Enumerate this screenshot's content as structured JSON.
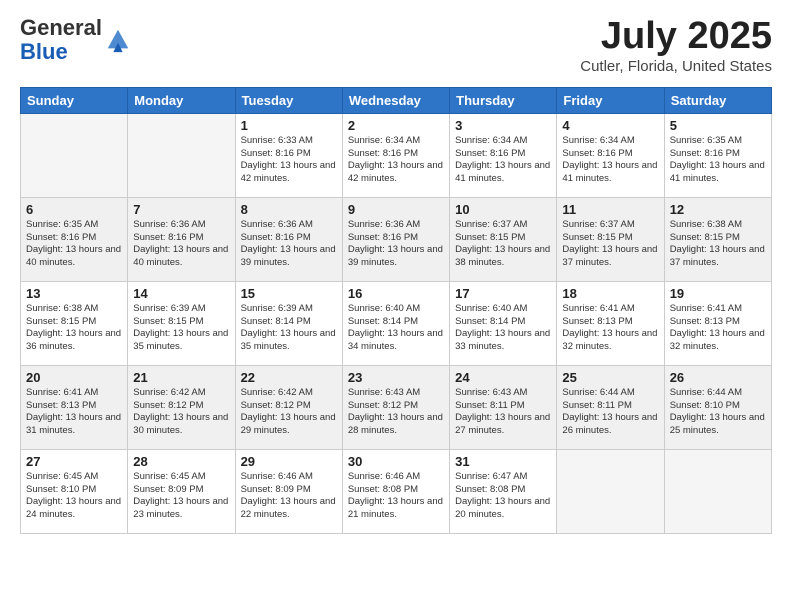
{
  "header": {
    "logo_general": "General",
    "logo_blue": "Blue",
    "title": "July 2025",
    "location": "Cutler, Florida, United States"
  },
  "days_of_week": [
    "Sunday",
    "Monday",
    "Tuesday",
    "Wednesday",
    "Thursday",
    "Friday",
    "Saturday"
  ],
  "weeks": [
    [
      {
        "day": "",
        "info": "",
        "empty": true
      },
      {
        "day": "",
        "info": "",
        "empty": true
      },
      {
        "day": "1",
        "info": "Sunrise: 6:33 AM\nSunset: 8:16 PM\nDaylight: 13 hours and 42 minutes.",
        "empty": false
      },
      {
        "day": "2",
        "info": "Sunrise: 6:34 AM\nSunset: 8:16 PM\nDaylight: 13 hours and 42 minutes.",
        "empty": false
      },
      {
        "day": "3",
        "info": "Sunrise: 6:34 AM\nSunset: 8:16 PM\nDaylight: 13 hours and 41 minutes.",
        "empty": false
      },
      {
        "day": "4",
        "info": "Sunrise: 6:34 AM\nSunset: 8:16 PM\nDaylight: 13 hours and 41 minutes.",
        "empty": false
      },
      {
        "day": "5",
        "info": "Sunrise: 6:35 AM\nSunset: 8:16 PM\nDaylight: 13 hours and 41 minutes.",
        "empty": false
      }
    ],
    [
      {
        "day": "6",
        "info": "Sunrise: 6:35 AM\nSunset: 8:16 PM\nDaylight: 13 hours and 40 minutes.",
        "empty": false
      },
      {
        "day": "7",
        "info": "Sunrise: 6:36 AM\nSunset: 8:16 PM\nDaylight: 13 hours and 40 minutes.",
        "empty": false
      },
      {
        "day": "8",
        "info": "Sunrise: 6:36 AM\nSunset: 8:16 PM\nDaylight: 13 hours and 39 minutes.",
        "empty": false
      },
      {
        "day": "9",
        "info": "Sunrise: 6:36 AM\nSunset: 8:16 PM\nDaylight: 13 hours and 39 minutes.",
        "empty": false
      },
      {
        "day": "10",
        "info": "Sunrise: 6:37 AM\nSunset: 8:15 PM\nDaylight: 13 hours and 38 minutes.",
        "empty": false
      },
      {
        "day": "11",
        "info": "Sunrise: 6:37 AM\nSunset: 8:15 PM\nDaylight: 13 hours and 37 minutes.",
        "empty": false
      },
      {
        "day": "12",
        "info": "Sunrise: 6:38 AM\nSunset: 8:15 PM\nDaylight: 13 hours and 37 minutes.",
        "empty": false
      }
    ],
    [
      {
        "day": "13",
        "info": "Sunrise: 6:38 AM\nSunset: 8:15 PM\nDaylight: 13 hours and 36 minutes.",
        "empty": false
      },
      {
        "day": "14",
        "info": "Sunrise: 6:39 AM\nSunset: 8:15 PM\nDaylight: 13 hours and 35 minutes.",
        "empty": false
      },
      {
        "day": "15",
        "info": "Sunrise: 6:39 AM\nSunset: 8:14 PM\nDaylight: 13 hours and 35 minutes.",
        "empty": false
      },
      {
        "day": "16",
        "info": "Sunrise: 6:40 AM\nSunset: 8:14 PM\nDaylight: 13 hours and 34 minutes.",
        "empty": false
      },
      {
        "day": "17",
        "info": "Sunrise: 6:40 AM\nSunset: 8:14 PM\nDaylight: 13 hours and 33 minutes.",
        "empty": false
      },
      {
        "day": "18",
        "info": "Sunrise: 6:41 AM\nSunset: 8:13 PM\nDaylight: 13 hours and 32 minutes.",
        "empty": false
      },
      {
        "day": "19",
        "info": "Sunrise: 6:41 AM\nSunset: 8:13 PM\nDaylight: 13 hours and 32 minutes.",
        "empty": false
      }
    ],
    [
      {
        "day": "20",
        "info": "Sunrise: 6:41 AM\nSunset: 8:13 PM\nDaylight: 13 hours and 31 minutes.",
        "empty": false
      },
      {
        "day": "21",
        "info": "Sunrise: 6:42 AM\nSunset: 8:12 PM\nDaylight: 13 hours and 30 minutes.",
        "empty": false
      },
      {
        "day": "22",
        "info": "Sunrise: 6:42 AM\nSunset: 8:12 PM\nDaylight: 13 hours and 29 minutes.",
        "empty": false
      },
      {
        "day": "23",
        "info": "Sunrise: 6:43 AM\nSunset: 8:12 PM\nDaylight: 13 hours and 28 minutes.",
        "empty": false
      },
      {
        "day": "24",
        "info": "Sunrise: 6:43 AM\nSunset: 8:11 PM\nDaylight: 13 hours and 27 minutes.",
        "empty": false
      },
      {
        "day": "25",
        "info": "Sunrise: 6:44 AM\nSunset: 8:11 PM\nDaylight: 13 hours and 26 minutes.",
        "empty": false
      },
      {
        "day": "26",
        "info": "Sunrise: 6:44 AM\nSunset: 8:10 PM\nDaylight: 13 hours and 25 minutes.",
        "empty": false
      }
    ],
    [
      {
        "day": "27",
        "info": "Sunrise: 6:45 AM\nSunset: 8:10 PM\nDaylight: 13 hours and 24 minutes.",
        "empty": false
      },
      {
        "day": "28",
        "info": "Sunrise: 6:45 AM\nSunset: 8:09 PM\nDaylight: 13 hours and 23 minutes.",
        "empty": false
      },
      {
        "day": "29",
        "info": "Sunrise: 6:46 AM\nSunset: 8:09 PM\nDaylight: 13 hours and 22 minutes.",
        "empty": false
      },
      {
        "day": "30",
        "info": "Sunrise: 6:46 AM\nSunset: 8:08 PM\nDaylight: 13 hours and 21 minutes.",
        "empty": false
      },
      {
        "day": "31",
        "info": "Sunrise: 6:47 AM\nSunset: 8:08 PM\nDaylight: 13 hours and 20 minutes.",
        "empty": false
      },
      {
        "day": "",
        "info": "",
        "empty": true
      },
      {
        "day": "",
        "info": "",
        "empty": true
      }
    ]
  ]
}
